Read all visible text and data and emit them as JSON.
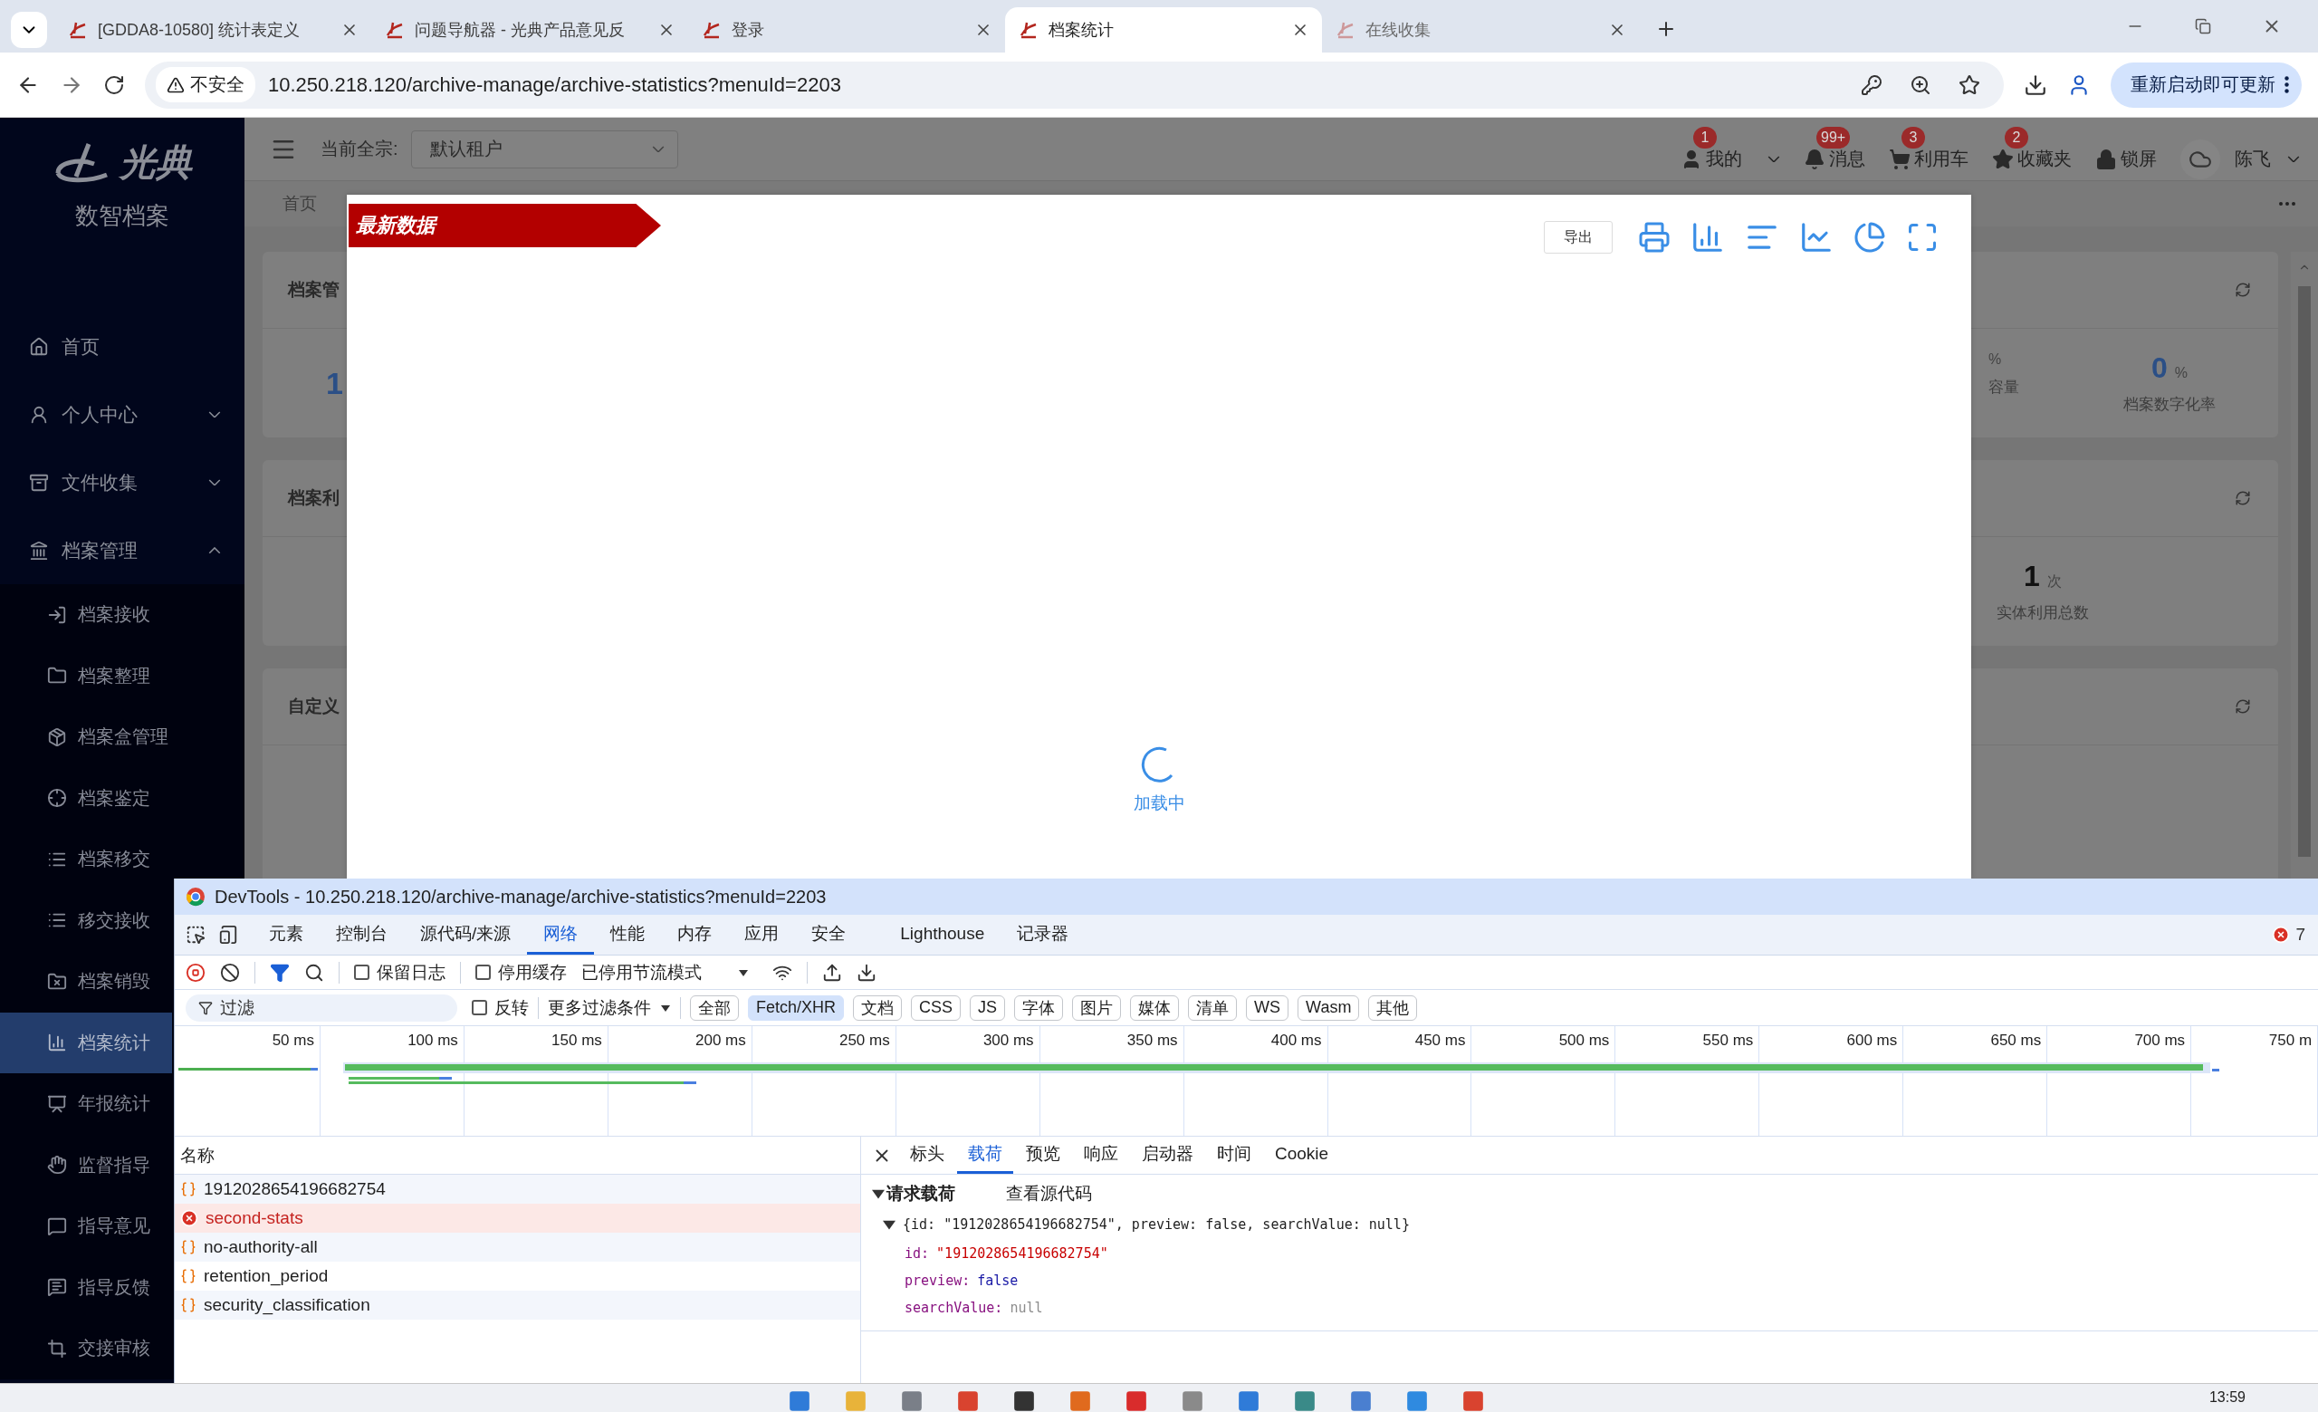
{
  "browser": {
    "tabs": [
      {
        "title": "[GDDA8-10580] 统计表定义",
        "selected": false,
        "dimmed": false
      },
      {
        "title": "问题导航器 - 光典产品意见反",
        "selected": false,
        "dimmed": false
      },
      {
        "title": "登录",
        "selected": false,
        "dimmed": false
      },
      {
        "title": "档案统计",
        "selected": true,
        "dimmed": false
      },
      {
        "title": "在线收集",
        "selected": false,
        "dimmed": true
      }
    ],
    "security": "不安全",
    "url": "10.250.218.120/archive-manage/archive-statistics?menuId=2203",
    "update_button": "重新启动即可更新"
  },
  "sidebar": {
    "brand": "光典",
    "subtitle": "数智档案",
    "items": [
      {
        "label": "首页",
        "kind": "link",
        "selected": false
      },
      {
        "label": "个人中心",
        "kind": "group",
        "expanded": false,
        "selected": false
      },
      {
        "label": "文件收集",
        "kind": "group",
        "expanded": false,
        "selected": false
      },
      {
        "label": "档案管理",
        "kind": "group",
        "expanded": true,
        "selected": false,
        "children": [
          {
            "label": "档案接收",
            "selected": false
          },
          {
            "label": "档案整理",
            "selected": false
          },
          {
            "label": "档案盒管理",
            "selected": false
          },
          {
            "label": "档案鉴定",
            "selected": false
          },
          {
            "label": "档案移交",
            "selected": false
          },
          {
            "label": "移交接收",
            "selected": false
          },
          {
            "label": "档案销毁",
            "selected": false
          },
          {
            "label": "档案统计",
            "selected": true
          },
          {
            "label": "年报统计",
            "selected": false
          },
          {
            "label": "监督指导",
            "selected": false
          },
          {
            "label": "指导意见",
            "selected": false
          },
          {
            "label": "指导反馈",
            "selected": false
          },
          {
            "label": "交接审核",
            "selected": false
          }
        ]
      }
    ]
  },
  "header": {
    "fonds_label": "当前全宗:",
    "fonds_value": "默认租户",
    "actions": [
      {
        "label": "我的",
        "badge": "1",
        "kind": "menu"
      },
      {
        "label": "消息",
        "badge": "99+",
        "kind": "plain"
      },
      {
        "label": "利用车",
        "badge": "3",
        "kind": "plain"
      },
      {
        "label": "收藏夹",
        "badge": "2",
        "kind": "plain"
      },
      {
        "label": "锁屏",
        "kind": "plain"
      }
    ],
    "user": "陈飞"
  },
  "page_tabs": [
    {
      "label": "首页"
    }
  ],
  "cards": [
    {
      "title": "档案管",
      "left_value": "1",
      "stats": [
        {
          "unit": "%",
          "label": "容量"
        },
        {
          "value": "0",
          "unit": "%",
          "label": "档案数字化率"
        }
      ]
    },
    {
      "title": "档案利",
      "stats": [
        {
          "value": "1",
          "unit": "次",
          "label": "实体利用总数"
        }
      ]
    },
    {
      "title": "自定义"
    }
  ],
  "modal": {
    "ribbon": "最新数据",
    "export_button": "导出",
    "loading": "加载中"
  },
  "devtools": {
    "title": "DevTools - 10.250.218.120/archive-manage/archive-statistics?menuId=2203",
    "tabs": [
      {
        "label": "元素",
        "selected": false
      },
      {
        "label": "控制台",
        "selected": false
      },
      {
        "label": "源代码/来源",
        "selected": false
      },
      {
        "label": "网络",
        "selected": true
      },
      {
        "label": "性能",
        "selected": false
      },
      {
        "label": "内存",
        "selected": false
      },
      {
        "label": "应用",
        "selected": false
      },
      {
        "label": "安全",
        "selected": false
      },
      {
        "label": "Lighthouse",
        "selected": false
      },
      {
        "label": "记录器",
        "selected": false
      }
    ],
    "error_count": "7",
    "preserve_log": {
      "label": "保留日志",
      "checked": false
    },
    "disable_cache": {
      "label": "停用缓存",
      "checked": false
    },
    "throttling": "已停用节流模式",
    "filter": {
      "placeholder": "过滤",
      "invert": {
        "label": "反转",
        "checked": false
      },
      "more_filters": "更多过滤条件",
      "types": [
        {
          "label": "全部",
          "selected": false
        },
        {
          "label": "Fetch/XHR",
          "selected": true
        },
        {
          "label": "文档",
          "selected": false
        },
        {
          "label": "CSS",
          "selected": false
        },
        {
          "label": "JS",
          "selected": false
        },
        {
          "label": "字体",
          "selected": false
        },
        {
          "label": "图片",
          "selected": false
        },
        {
          "label": "媒体",
          "selected": false
        },
        {
          "label": "清单",
          "selected": false
        },
        {
          "label": "WS",
          "selected": false
        },
        {
          "label": "Wasm",
          "selected": false
        },
        {
          "label": "其他",
          "selected": false
        }
      ]
    },
    "timeline": {
      "ticks": [
        "50 ms",
        "100 ms",
        "150 ms",
        "200 ms",
        "250 ms",
        "300 ms",
        "350 ms",
        "400 ms",
        "450 ms",
        "500 ms",
        "550 ms",
        "600 ms",
        "650 ms",
        "700 ms",
        "750 m"
      ]
    },
    "requests": {
      "column": "名称",
      "rows": [
        {
          "name": "1912028654196682754",
          "kind": "fetch",
          "selected": false
        },
        {
          "name": "second-stats",
          "kind": "failed",
          "selected": true
        },
        {
          "name": "no-authority-all",
          "kind": "fetch",
          "selected": false
        },
        {
          "name": "retention_period",
          "kind": "fetch",
          "selected": false
        },
        {
          "name": "security_classification",
          "kind": "fetch",
          "selected": false
        }
      ]
    },
    "detail": {
      "tabs": [
        {
          "label": "标头",
          "selected": false
        },
        {
          "label": "载荷",
          "selected": true
        },
        {
          "label": "预览",
          "selected": false
        },
        {
          "label": "响应",
          "selected": false
        },
        {
          "label": "启动器",
          "selected": false
        },
        {
          "label": "时间",
          "selected": false
        },
        {
          "label": "Cookie",
          "selected": false
        }
      ],
      "section": {
        "label": "请求载荷",
        "expanded": true
      },
      "view_source": "查看源代码",
      "summary": {
        "text": "{id: \"1912028654196682754\", preview: false, searchValue: null}",
        "expanded": true
      },
      "fields": [
        {
          "key": "id:",
          "value": "\"1912028654196682754\"",
          "kind": "string"
        },
        {
          "key": "preview:",
          "value": "false",
          "kind": "boolean"
        },
        {
          "key": "searchValue:",
          "value": "null",
          "kind": "null"
        }
      ]
    }
  },
  "taskbar": {
    "time": "13:59"
  }
}
